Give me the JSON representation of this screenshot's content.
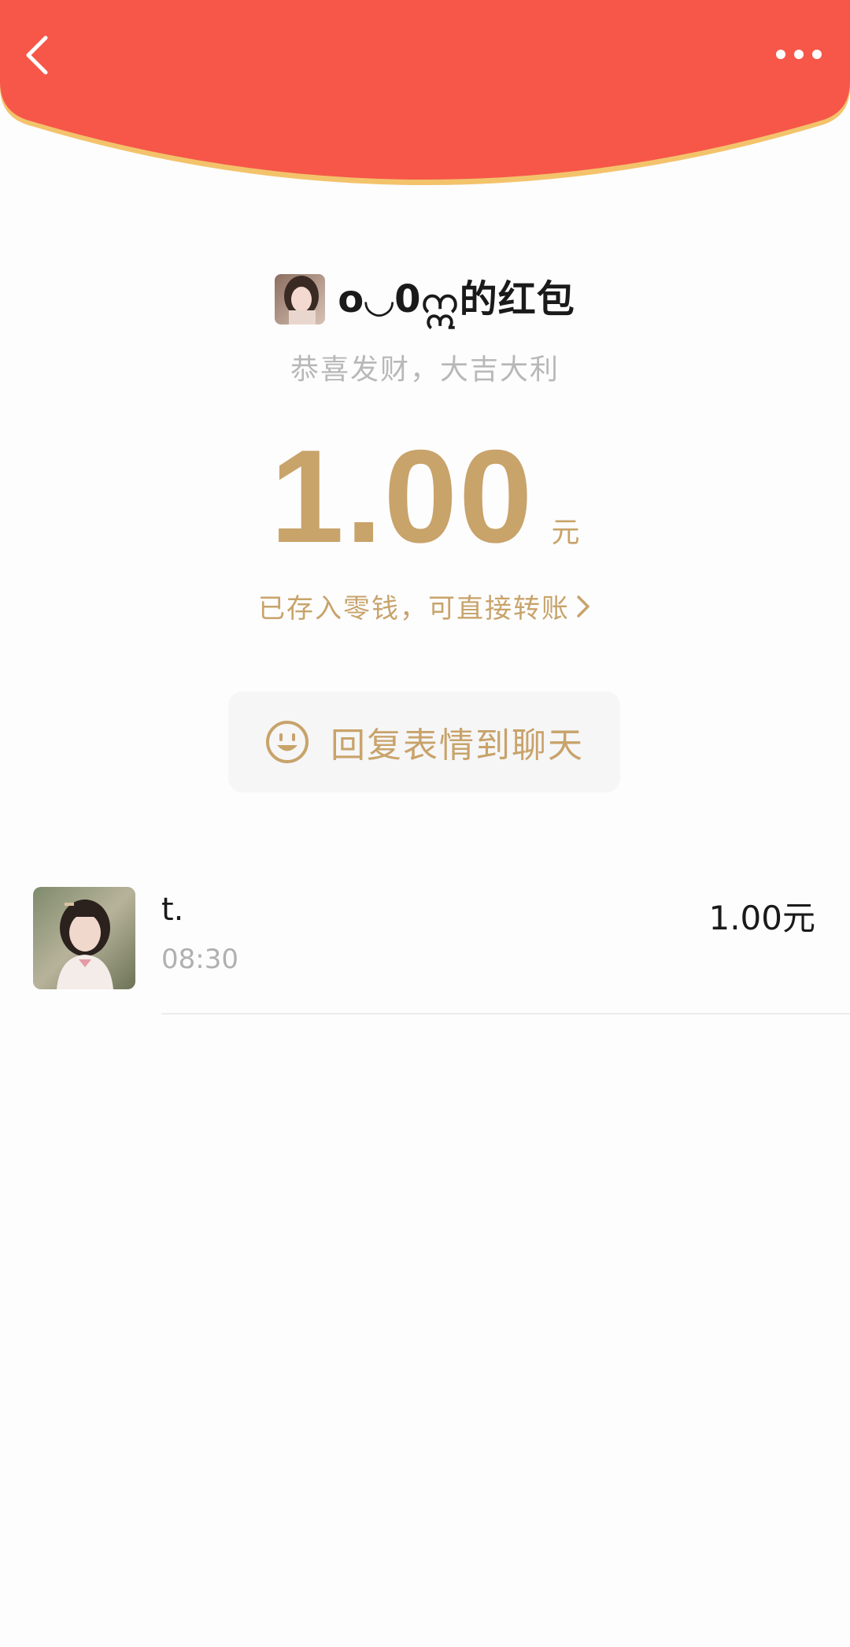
{
  "header": {
    "back_icon": "chevron-left-icon",
    "more_icon": "more-horizontal-icon",
    "color": "#f65749",
    "rim_color": "#f3c36b"
  },
  "packet": {
    "sender_name": "o◡0ဣ的红包",
    "blessing": "恭喜发财，大吉大利",
    "amount": "1.00",
    "unit": "元",
    "stored_text": "已存入零钱，可直接转账",
    "accent_color": "#c8a36a"
  },
  "reply": {
    "label": "回复表情到聊天",
    "icon": "smiley-icon"
  },
  "receivers": [
    {
      "name": "t.",
      "time": "08:30",
      "amount": "1.00元"
    }
  ]
}
